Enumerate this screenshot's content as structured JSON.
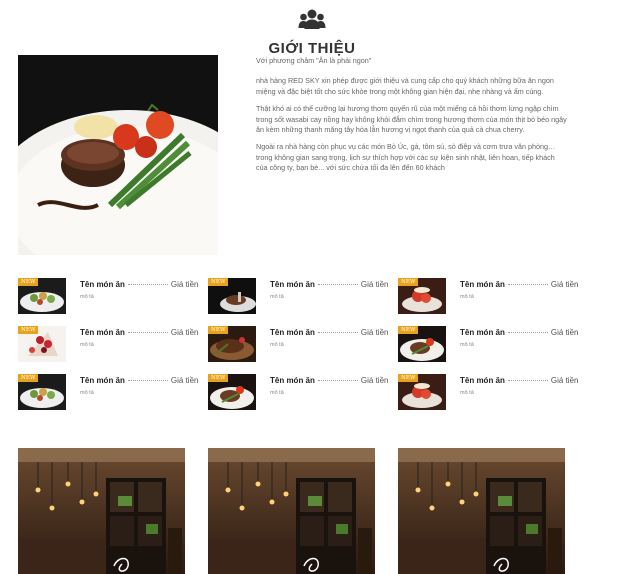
{
  "header": {
    "icon": "group-users-icon",
    "title": "GIỚI THIỆU"
  },
  "intro": {
    "slogan": "Với phương châm \"Ăn là phải ngon\"",
    "paragraphs": [
      "nhà hàng RED SKY xin phép được giới thiệu và cung cấp cho quý khách những bữa ăn ngon miệng và đặc biệt tốt cho sức khỏe trong một không gian hiện đại, nhẹ nhàng và ấm cúng.",
      "Thật khó ai có thể cưỡng lại hương thơm quyến rũ của một miếng cá hồi thơm lừng ngập chìm trong sốt wasabi cay nồng hay không khỏi đắm chìm trong hương thơm của món thịt bò béo ngậy ăn kèm những thanh măng tây hòa lẫn hương vị ngọt thanh của quả cà chua cherry.",
      "Ngoài ra nhà hàng còn phục vụ các món Bò Úc, gà, tôm sú, sò điệp và cơm trưa văn phòng… trong không gian sang trọng, lịch sự thích hợp với các sự kiện sinh nhật, liên hoan, tiếp khách của công ty, bạn bè... với sức chứa tối đa lên đến 60 khách"
    ]
  },
  "menu": {
    "badge": "NEW",
    "items": [
      {
        "name": "Tên món ăn",
        "price": "Giá tiền",
        "desc": "mô tả",
        "thumb": "salad"
      },
      {
        "name": "Tên món ăn",
        "price": "Giá tiền",
        "desc": "mô tả",
        "thumb": "steak-dark"
      },
      {
        "name": "Tên món ăn",
        "price": "Giá tiền",
        "desc": "mô tả",
        "thumb": "dessert"
      },
      {
        "name": "Tên món ăn",
        "price": "Giá tiền",
        "desc": "mô tả",
        "thumb": "berries"
      },
      {
        "name": "Tên món ăn",
        "price": "Giá tiền",
        "desc": "mô tả",
        "thumb": "steak"
      },
      {
        "name": "Tên món ăn",
        "price": "Giá tiền",
        "desc": "mô tả",
        "thumb": "steak-plate"
      },
      {
        "name": "Tên món ăn",
        "price": "Giá tiền",
        "desc": "mô tả",
        "thumb": "salad"
      },
      {
        "name": "Tên món ăn",
        "price": "Giá tiền",
        "desc": "mô tả",
        "thumb": "steak-plate"
      },
      {
        "name": "Tên món ăn",
        "price": "Giá tiền",
        "desc": "mô tả",
        "thumb": "dessert"
      }
    ]
  },
  "colors": {
    "badge": "#e9a31b",
    "title": "#333333",
    "text": "#666666"
  }
}
